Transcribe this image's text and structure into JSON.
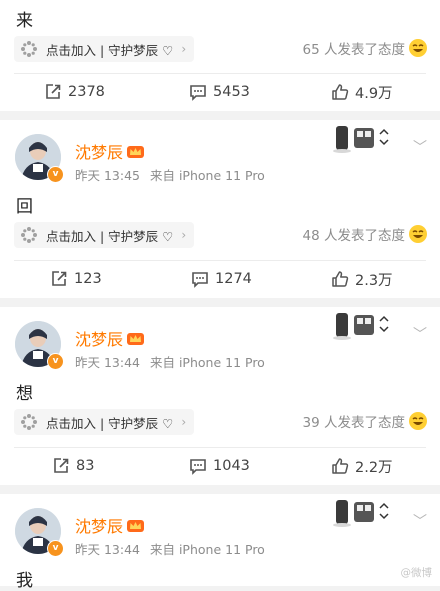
{
  "follow_chip_label": "点击加入 | 守护梦辰 ♡",
  "feed": [
    {
      "post_text": "来",
      "reactions": "65 人发表了态度",
      "reposts": "2378",
      "comments": "5453",
      "likes": "4.9万"
    },
    {
      "user": "沈梦辰",
      "time": "昨天 13:45",
      "source": "来自 iPhone 11 Pro",
      "post_text": "回",
      "reactions": "48 人发表了态度",
      "reposts": "123",
      "comments": "1274",
      "likes": "2.3万"
    },
    {
      "user": "沈梦辰",
      "time": "昨天 13:44",
      "source": "来自 iPhone 11 Pro",
      "post_text": "想",
      "reactions": "39 人发表了态度",
      "reposts": "83",
      "comments": "1043",
      "likes": "2.2万"
    },
    {
      "user": "沈梦辰",
      "time": "昨天 13:44",
      "source": "来自 iPhone 11 Pro",
      "post_text": "我"
    }
  ],
  "verified_badge": "v",
  "watermark": "@微博",
  "colors": {
    "username": "#ff7a00",
    "badge": "#f7931e",
    "meta": "#8c8c8c",
    "background": "#f2f2f2"
  },
  "icons": [
    "repost-icon",
    "comment-icon",
    "like-icon",
    "chevron-down-icon",
    "crown-icon",
    "laugh-emoji-icon",
    "grid-icon"
  ]
}
